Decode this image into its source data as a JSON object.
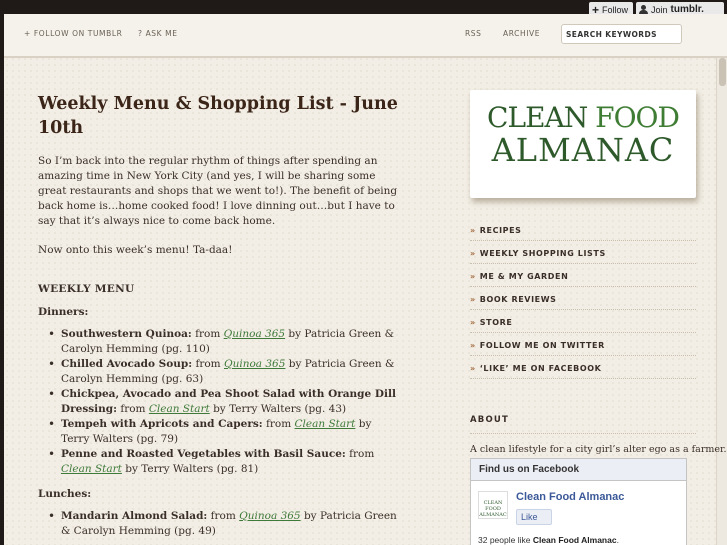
{
  "tumblr_bar": {
    "follow_label": "Follow",
    "join_label": "Join",
    "join_brand": "tumblr."
  },
  "topnav": {
    "follow_on_tumblr": "+ FOLLOW ON TUMBLR",
    "ask_me": "? ASK ME",
    "rss": "RSS",
    "archive": "ARCHIVE",
    "search_placeholder": "SEARCH KEYWORDS"
  },
  "post": {
    "title": "Weekly Menu & Shopping List - June 10th",
    "intro": "So I’m back into the regular rhythm of things after spending an amazing time in New York City (and yes, I will be sharing some great restaurants and shops that we went to!).  The benefit of being back home is…home cooked food!  I love dinning out…but I have to say that it’s always nice to come back home.",
    "onto": "Now onto this week’s menu! Ta-daa!",
    "section_heading": "WEEKLY MENU",
    "dinners_heading": "Dinners:",
    "dinners": [
      {
        "dish": "Southwestern Quinoa:",
        "pre": " from ",
        "book": "Quinoa 365",
        "post": " by Patricia Green & Carolyn Hemming (pg. 110)"
      },
      {
        "dish": "Chilled Avocado Soup:",
        "pre": " from ",
        "book": "Quinoa 365",
        "post": " by Patricia Green & Carolyn Hemming (pg. 63)"
      },
      {
        "dish": "Chickpea, Avocado and Pea Shoot Salad with Orange Dill Dressing:",
        "pre": " from ",
        "book": "Clean Start",
        "post": " by Terry Walters (pg. 43)"
      },
      {
        "dish": "Tempeh with Apricots and Capers:",
        "pre": " from ",
        "book": "Clean Start",
        "post": " by Terry Walters (pg. 79)"
      },
      {
        "dish": "Penne and Roasted Vegetables with Basil Sauce:",
        "pre": " from ",
        "book": "Clean Start",
        "post": " by Terry Walters (pg. 81)"
      }
    ],
    "lunches_heading": "Lunches:",
    "lunches": [
      {
        "dish": "Mandarin Almond Salad:",
        "pre": " from ",
        "book": "Quinoa 365",
        "post": " by Patricia Green & Carolyn Hemming (pg. 49)"
      }
    ]
  },
  "sidebar": {
    "logo_line1_a": "CLEAN",
    "logo_line1_b": "FOOD",
    "logo_line2": "ALMANAC",
    "nav": [
      "RECIPES",
      "WEEKLY SHOPPING LISTS",
      "ME & MY GARDEN",
      "BOOK REVIEWS",
      "STORE",
      "FOLLOW ME ON TWITTER",
      "‘LIKE’ ME ON FACEBOOK"
    ],
    "about_heading": "ABOUT",
    "about_text": "A clean lifestyle for a city girl’s alter ego as a farmer.",
    "facebook": {
      "header": "Find us on Facebook",
      "thumb_text": "CLEAN FOOD ALMANAC",
      "page_name": "Clean Food Almanac",
      "like_label": "Like",
      "count_text": "32 people like ",
      "count_name": "Clean Food Almanac",
      "count_end": "."
    }
  }
}
